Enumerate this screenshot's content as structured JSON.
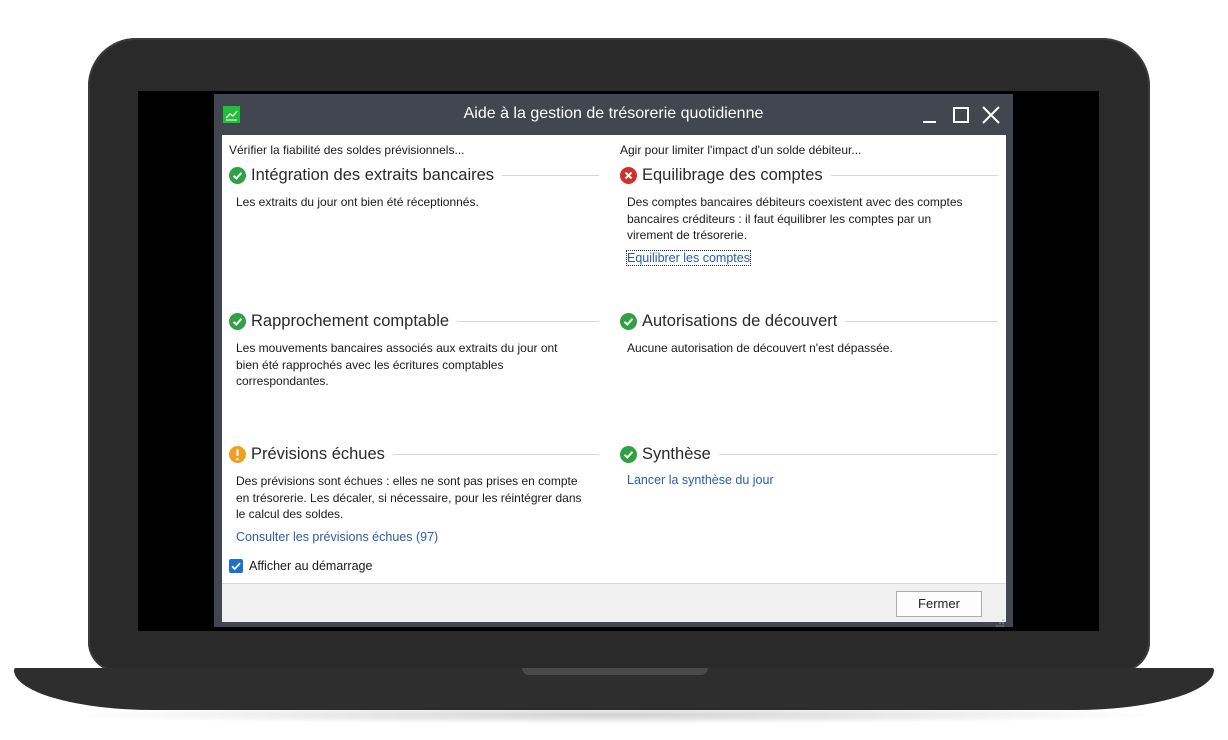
{
  "window": {
    "title": "Aide à la gestion de trésorerie quotidienne",
    "app_icon": "chart-icon",
    "controls": [
      "minimize-icon",
      "maximize-icon",
      "close-icon"
    ]
  },
  "left_column": {
    "heading": "Vérifier la fiabilité des soldes prévisionnels...",
    "sections": [
      {
        "status": "ok",
        "title": "Intégration des extraits bancaires",
        "text": [
          "Les extraits du jour ont bien été réceptionnés."
        ]
      },
      {
        "status": "ok",
        "title": "Rapprochement comptable",
        "text": [
          "Les mouvements bancaires associés aux extraits du jour ont",
          "bien été rapprochés avec les écritures comptables",
          "correspondantes."
        ]
      },
      {
        "status": "warning",
        "title": "Prévisions échues",
        "text": [
          "Des prévisions sont échues : elles ne sont pas prises en compte",
          "en trésorerie. Les décaler, si nécessaire, pour les réintégrer dans",
          "le calcul des soldes."
        ],
        "link": "Consulter les prévisions échues (97)"
      }
    ]
  },
  "right_column": {
    "heading": "Agir pour limiter l'impact d'un solde débiteur...",
    "sections": [
      {
        "status": "error",
        "title": "Equilibrage des comptes",
        "text": [
          "Des comptes bancaires débiteurs coexistent avec des comptes",
          "bancaires créditeurs : il faut équilibrer les comptes par un",
          "virement de trésorerie."
        ],
        "link": "Equilibrer les comptes"
      },
      {
        "status": "ok",
        "title": "Autorisations de découvert",
        "text": [
          "Aucune autorisation de découvert n'est dépassée."
        ]
      },
      {
        "status": "ok",
        "title": "Synthèse",
        "link": "Lancer la synthèse du jour"
      }
    ]
  },
  "startup_checkbox": {
    "label": "Afficher au démarrage",
    "checked": true
  },
  "footer": {
    "close_label": "Fermer"
  },
  "colors": {
    "ok": "#2fa043",
    "error": "#d0302a",
    "warning": "#f0a020",
    "link": "#2a5db0",
    "titlebar": "#414650"
  }
}
